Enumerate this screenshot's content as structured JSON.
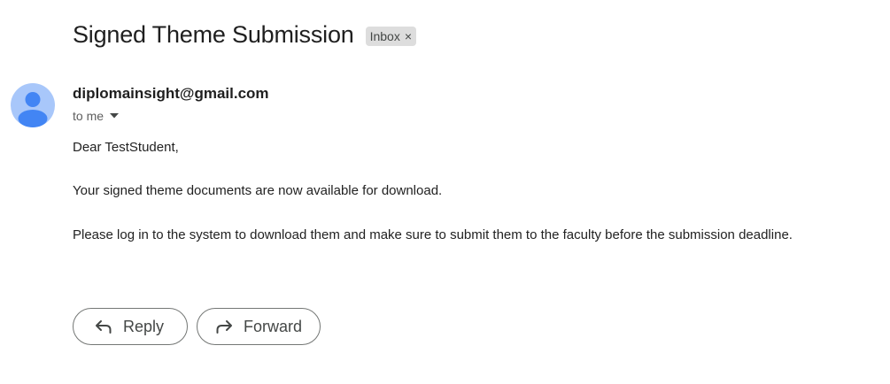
{
  "email": {
    "subject": "Signed Theme Submission",
    "label": "Inbox",
    "label_remove_glyph": "×",
    "sender": "diplomainsight@gmail.com",
    "recipient": "to me",
    "greeting": "Dear TestStudent,",
    "paragraphs": [
      "Your signed theme documents are now available for download.",
      "Please log in to the system to download them and make sure to submit them to the faculty before the submission deadline."
    ]
  },
  "actions": {
    "reply_label": "Reply",
    "forward_label": "Forward"
  },
  "icons": {
    "avatar": "default-person-avatar",
    "recipient_toggle": "caret-down-icon",
    "reply": "reply-arrow-icon",
    "forward": "forward-arrow-icon"
  },
  "colors": {
    "avatar_background": "#a8c7fa",
    "avatar_figure": "#4285f4",
    "label_chip_background": "#dddddd",
    "button_border": "#747775"
  }
}
